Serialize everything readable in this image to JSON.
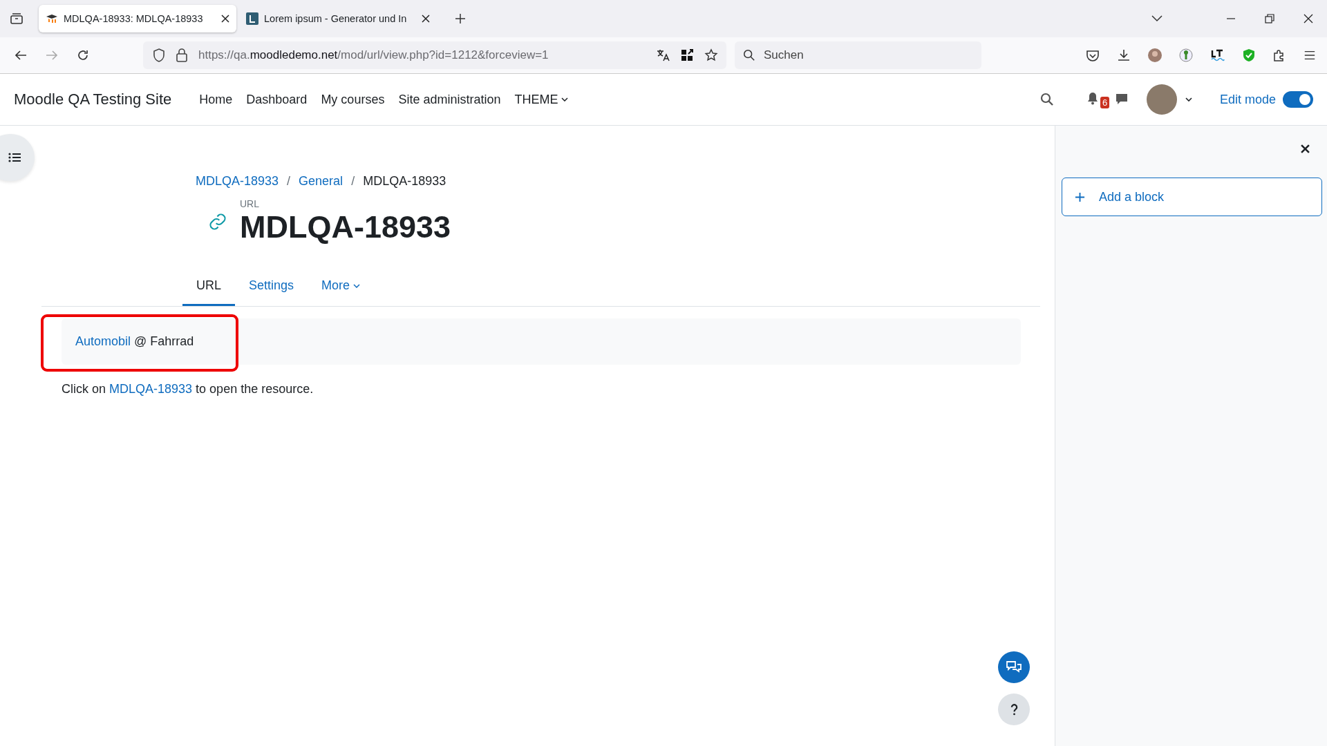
{
  "browser": {
    "tabs": [
      {
        "title": "MDLQA-18933: MDLQA-18933",
        "selected": true
      },
      {
        "title": "Lorem ipsum - Generator und In",
        "selected": false
      }
    ],
    "url": {
      "scheme": "https://qa.",
      "host": "moodledemo.net",
      "path": "/mod/url/view.php?id=1212&forceview=1"
    },
    "search": {
      "placeholder": "Suchen"
    }
  },
  "navbar": {
    "site_name": "Moodle QA Testing Site",
    "menu": [
      {
        "label": "Home",
        "kind": "link"
      },
      {
        "label": "Dashboard",
        "kind": "link"
      },
      {
        "label": "My courses",
        "kind": "link"
      },
      {
        "label": "Site administration",
        "kind": "link"
      },
      {
        "label": "THEME",
        "kind": "dropdown"
      }
    ],
    "notification_count": "6",
    "edit_mode": {
      "label": "Edit mode",
      "on": true
    }
  },
  "breadcrumb": [
    {
      "label": "MDLQA-18933",
      "link": true
    },
    {
      "separator": "/",
      "label": "General",
      "link": true
    },
    {
      "separator": "/",
      "label": "MDLQA-18933",
      "link": false
    }
  ],
  "activity": {
    "type_label": "URL",
    "title": "MDLQA-18933"
  },
  "tabs": [
    {
      "label": "URL",
      "selected": true,
      "kind": "link"
    },
    {
      "label": "Settings",
      "selected": false,
      "kind": "link"
    },
    {
      "label": "More",
      "selected": false,
      "kind": "dropdown"
    }
  ],
  "url_box": {
    "link": "Automobil",
    "text": "@ Fahrrad"
  },
  "instruction": {
    "before": "Click on",
    "link": "MDLQA-18933",
    "after": "to open the resource."
  },
  "drawer": {
    "add_block": "Add a block"
  }
}
